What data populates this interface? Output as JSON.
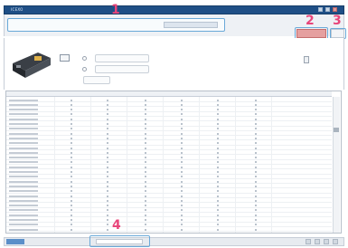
{
  "window": {
    "title": "ICEXO"
  },
  "toolbar": {
    "path_text": "",
    "path_button": ""
  },
  "actions": {
    "red_button": "",
    "small_button": ""
  },
  "markers": {
    "m1": "1",
    "m2": "2",
    "m3": "3",
    "m4": "4"
  },
  "panel": {
    "label": "",
    "link": "",
    "device_caption": ""
  },
  "grid": {
    "columns": [
      "",
      "",
      "",
      "",
      "",
      ""
    ],
    "row_count": 28
  },
  "statusbar": {
    "tab1": "",
    "tab2": "",
    "input": ""
  },
  "colors": {
    "accent": "#1f4f86",
    "highlight": "#6aa9d8",
    "marker": "#e8457a",
    "danger": "#e5a0a0"
  },
  "icons": [
    "device-icon",
    "mini-icon",
    "side-icon",
    "scroll-thumb"
  ]
}
